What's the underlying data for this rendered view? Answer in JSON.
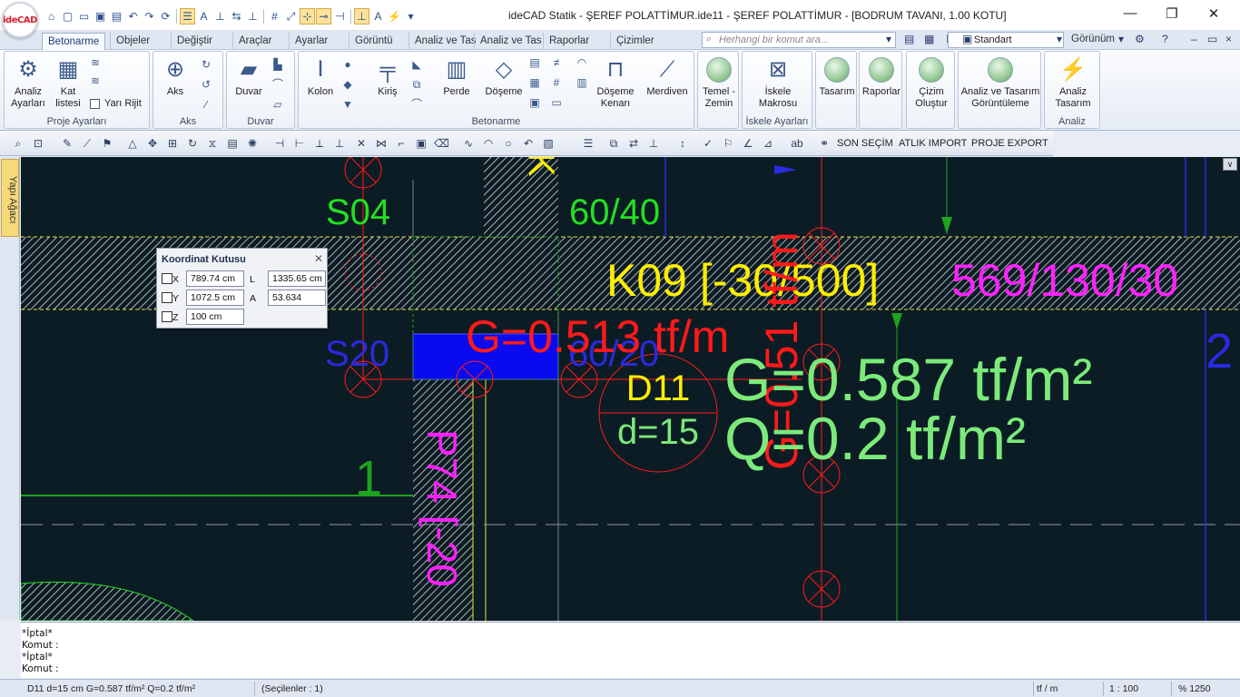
{
  "titlebar": {
    "title": "ideCAD Statik - ŞEREF POLATTİMUR.ide11 - ŞEREF POLATTİMUR - [BODRUM TAVANI,  1.00 KOTU]",
    "logo_text": "ideCAD",
    "minimize": "—",
    "maximize": "❐",
    "close": "✕"
  },
  "ribbon_tabs": [
    "Betonarme",
    "Objeler",
    "Değiştir",
    "Araçlar",
    "Ayarlar",
    "Görüntü",
    "Analiz ve Tas",
    "Analiz ve Tas",
    "Raporlar",
    "Çizimler"
  ],
  "active_tab": "Betonarme",
  "search": {
    "placeholder": "Herhangi bir komut ara..."
  },
  "style_select": {
    "value": "Standart"
  },
  "view_menu": "Görünüm",
  "groups": {
    "proje_ayarlari": {
      "title": "Proje Ayarları",
      "analiz": "Analiz\nAyarları",
      "kat": "Kat\nlistesi",
      "yari_rijit": "Yarı Rijit"
    },
    "aks": {
      "title": "Aks",
      "aks": "Aks"
    },
    "duvar": {
      "title": "Duvar",
      "duvar": "Duvar"
    },
    "betonarme": {
      "title": "Betonarme",
      "kolon": "Kolon",
      "kiris": "Kiriş",
      "perde": "Perde",
      "doseme": "Döşeme",
      "doseme_kenari": "Döşeme\nKenarı",
      "merdiven": "Merdiven"
    },
    "temel": {
      "label": "Temel -\nZemin"
    },
    "iskele": {
      "title": "İskele Ayarları",
      "label": "İskele\nMakrosu"
    },
    "tasarim": {
      "label": "Tasarım"
    },
    "raporlar": {
      "label": "Raporlar"
    },
    "cizim": {
      "label": "Çizim\nOluştur"
    },
    "analiz_gor": {
      "label": "Analiz ve Tasarım\nGörüntüleme"
    },
    "analiz": {
      "title": "Analiz",
      "label": "Analiz\nTasarım"
    }
  },
  "toolbar2": {
    "son_secim": "SON SEÇİM",
    "atlik_import": "ATLIK IMPORT",
    "proje_export": "PROJE EXPORT"
  },
  "sidetab": {
    "label": "Yapı Ağacı"
  },
  "coordbox": {
    "title": "Koordinat Kutusu",
    "x_label": "X",
    "x_value": "789.74 cm",
    "y_label": "Y",
    "y_value": "1072.5 cm",
    "z_label": "Z",
    "z_value": "100 cm",
    "l_label": "L",
    "l_value": "1335.65 cm",
    "a_label": "A",
    "a_value": "53.634"
  },
  "canvas": {
    "s04": "S04",
    "s04_size": "60/40",
    "k09": "K09 [-30/500]",
    "k09_dims": "569/130/30",
    "s20": "S20",
    "s20_size": "60/20",
    "g_beam": "G=0.513 tf/m",
    "g_vertical": "G=0.51 tf/m",
    "d11": "D11",
    "d11_thickness": "d=15",
    "slab_g": "G=0.587 tf/m²",
    "slab_q": "Q=0.2 tf/m²",
    "p74": "P74 [-20",
    "axis_1": "1",
    "axis_2": "2",
    "k_top": "K"
  },
  "command": {
    "lines": [
      "*İptal*",
      "Komut :",
      "*İptal*",
      "Komut :"
    ]
  },
  "statusbar": {
    "info": "D11 d=15 cm G=0.587 tf/m² Q=0.2 tf/m²",
    "selection": "(Seçilenler : 1)",
    "unit": "tf / m",
    "scale": "1 : 100",
    "zoom": "% 1250"
  },
  "colors": {
    "canvas_bg": "#0c1c24",
    "green_text": "#22e022",
    "yellow_text": "#ffee00",
    "magenta_text": "#ff22ff",
    "red_text": "#ff1a1a",
    "blue_text": "#2a2adf",
    "light_green_text": "#7bea7b",
    "selected_fill": "#0a0af0"
  }
}
